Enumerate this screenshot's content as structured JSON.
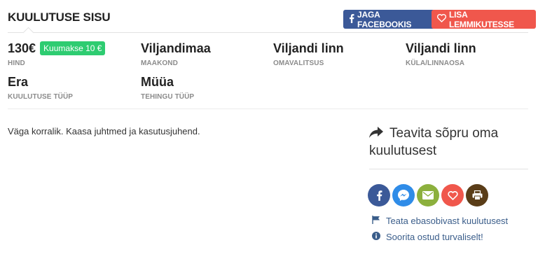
{
  "header": {
    "title": "KUULUTUSE SISU",
    "facebook_button": "JAGA FACEBOOKIS",
    "favorite_button": "LISA LEMMIKUTESSE"
  },
  "colors": {
    "facebook": "#3b5998",
    "favorite": "#f0574c",
    "badge": "#2ecc71",
    "messenger": "#2f8ce8",
    "email": "#8cb03d",
    "heart": "#f0574c",
    "print": "#5a3d18",
    "link": "#3a5d8a"
  },
  "fields": {
    "price": {
      "value": "130€",
      "label": "HIND",
      "badge": "Kuumakse 10 €"
    },
    "county": {
      "value": "Viljandimaa",
      "label": "MAAKOND"
    },
    "municipality": {
      "value": "Viljandi linn",
      "label": "OMAVALITSUS"
    },
    "village": {
      "value": "Viljandi linn",
      "label": "KÜLA/LINNAOSA"
    },
    "listing_type": {
      "value": "Era",
      "label": "KUULUTUSE TÜÜP"
    },
    "deal_type": {
      "value": "Müüa",
      "label": "TEHINGU TÜÜP"
    }
  },
  "description": "Väga korralik. Kaasa juhtmed ja kasutusjuhend.",
  "share": {
    "title": "Teavita sõpru oma kuulutusest",
    "icons": [
      "facebook-icon",
      "messenger-icon",
      "email-icon",
      "heart-icon",
      "print-icon"
    ]
  },
  "links": {
    "report": "Teata ebasobivast kuulutusest",
    "safe_buy": "Soorita ostud turvaliselt!"
  }
}
